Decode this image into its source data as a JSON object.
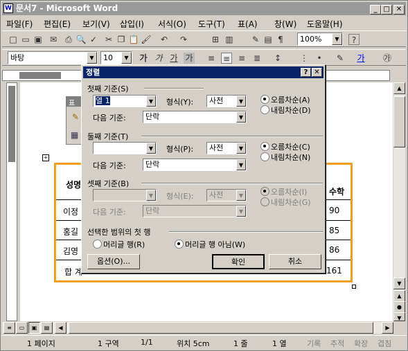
{
  "window": {
    "title": "문서7 - Microsoft Word",
    "min": "_",
    "max": "□",
    "close": "✕"
  },
  "menu": [
    "파일(F)",
    "편집(E)",
    "보기(V)",
    "삽입(I)",
    "서식(O)",
    "도구(T)",
    "표(A)",
    "창(W)",
    "도움말(H)"
  ],
  "toolbar": {
    "zoom": "100%",
    "help": "?"
  },
  "format": {
    "font": "바탕",
    "size": "10",
    "bold": "가",
    "italic": "가",
    "underline": "가",
    "shade": "가"
  },
  "table": {
    "header": "성명",
    "header_right": "수학",
    "rows": [
      {
        "name": "이정",
        "val": "90"
      },
      {
        "name": "홍길",
        "val": "85"
      },
      {
        "name": "김영",
        "val": "86"
      },
      {
        "name": "합 계",
        "val": "161"
      }
    ]
  },
  "float_toolbar": {
    "title": "표"
  },
  "dialog": {
    "title": "정렬",
    "help": "?",
    "close": "✕",
    "first": {
      "label": "첫째 기준(S)",
      "field": "열 1",
      "type_label": "형식(Y):",
      "type": "사전",
      "then_label": "다음 기준:",
      "then": "단락",
      "asc": "오름차순(A)",
      "desc": "내림차순(D)"
    },
    "second": {
      "label": "둘째 기준(T)",
      "field": "",
      "type_label": "형식(P):",
      "type": "사전",
      "then_label": "다음 기준:",
      "then": "단락",
      "asc": "오름차순(C)",
      "desc": "내림차순(N)"
    },
    "third": {
      "label": "셋째 기준(B)",
      "field": "",
      "type_label": "형식(E):",
      "type": "사전",
      "then_label": "다음 기준:",
      "then": "단락",
      "asc": "오름차순(I)",
      "desc": "내림차순(G)"
    },
    "header_row": {
      "label": "선택한 범위의 첫 행",
      "has": "머리글 행(R)",
      "no": "머리글 행 아님(W)"
    },
    "options": "옵션(O)...",
    "ok": "확인",
    "cancel": "취소"
  },
  "status": {
    "page": "1 페이지",
    "section": "1 구역",
    "pages": "1/1",
    "pos": "위치 5cm",
    "line": "1 줄",
    "col": "1 열",
    "rec": "기록",
    "trk": "추적",
    "ext": "확장",
    "ovr": "겹침"
  }
}
